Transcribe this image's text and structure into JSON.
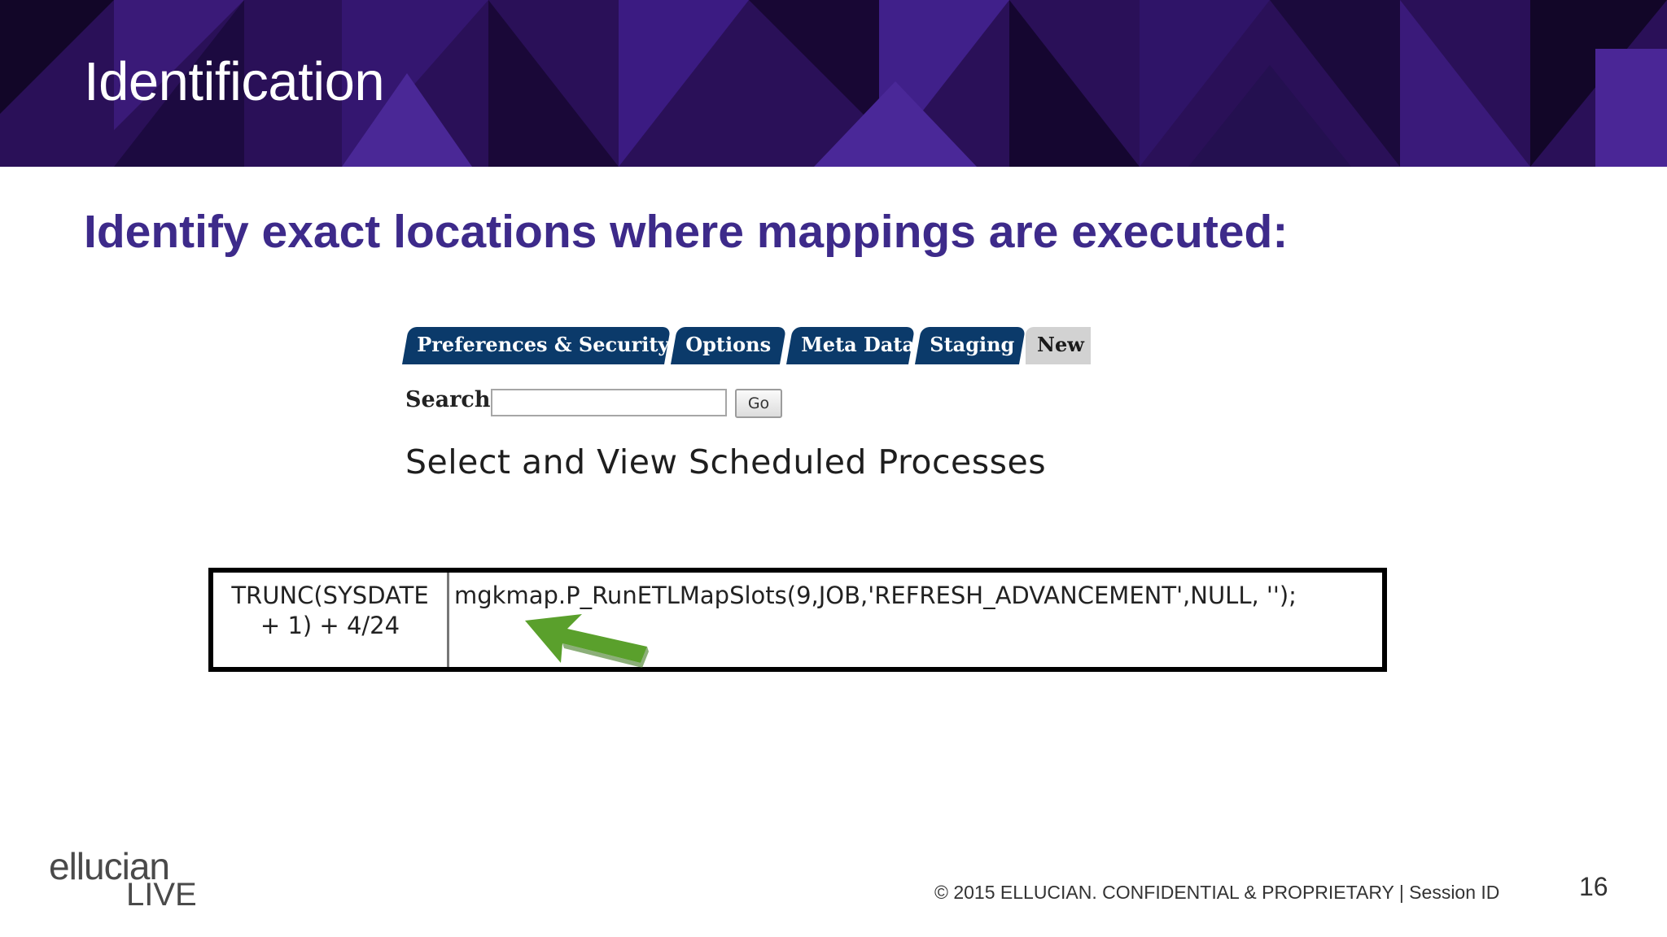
{
  "slide": {
    "title": "Identification",
    "subtitle": "Identify exact locations where mappings are executed:"
  },
  "app": {
    "tabs": [
      {
        "label": "Preferences & Security"
      },
      {
        "label": "Options"
      },
      {
        "label": "Meta Data"
      },
      {
        "label": "Staging"
      },
      {
        "label": "New \\"
      }
    ],
    "search": {
      "label": "Search",
      "value": "",
      "placeholder": ""
    },
    "go_label": "Go",
    "page_heading": "Select and View Scheduled Processes"
  },
  "job_table": {
    "when_line1": "TRUNC(SYSDATE",
    "when_line2": "+ 1) + 4/24",
    "what": "mgkmap.P_RunETLMapSlots(9,JOB,'REFRESH_ADVANCEMENT',NULL, '');"
  },
  "footer": {
    "logo_top": "ellucian",
    "logo_bottom": "LIVE",
    "copyright": "© 2015 ELLUCIAN. CONFIDENTIAL & PROPRIETARY   |   Session ID",
    "page_number": "16"
  },
  "colors": {
    "banner": "#2a1058",
    "subtitle": "#3d2a8a",
    "tab": "#0b3a6a",
    "arrow": "#5aa02c"
  }
}
